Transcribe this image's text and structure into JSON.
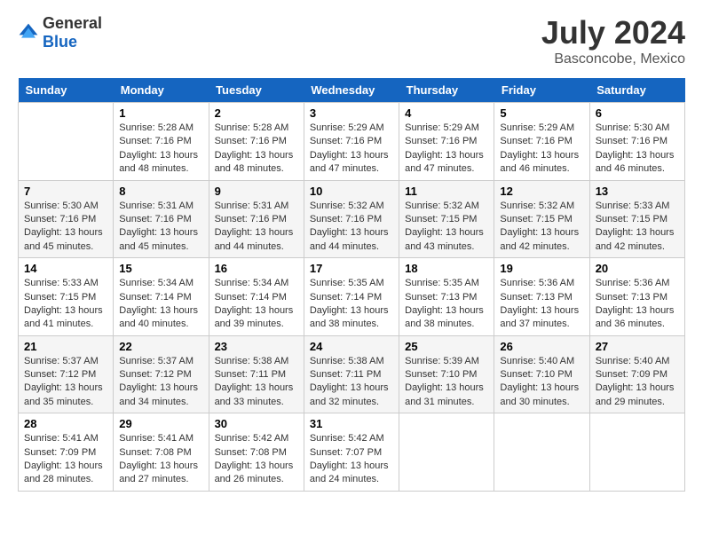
{
  "header": {
    "logo_general": "General",
    "logo_blue": "Blue",
    "title": "July 2024",
    "subtitle": "Basconcobe, Mexico"
  },
  "calendar": {
    "days_of_week": [
      "Sunday",
      "Monday",
      "Tuesday",
      "Wednesday",
      "Thursday",
      "Friday",
      "Saturday"
    ],
    "weeks": [
      [
        {
          "day": "",
          "info": ""
        },
        {
          "day": "1",
          "info": "Sunrise: 5:28 AM\nSunset: 7:16 PM\nDaylight: 13 hours and 48 minutes."
        },
        {
          "day": "2",
          "info": "Sunrise: 5:28 AM\nSunset: 7:16 PM\nDaylight: 13 hours and 48 minutes."
        },
        {
          "day": "3",
          "info": "Sunrise: 5:29 AM\nSunset: 7:16 PM\nDaylight: 13 hours and 47 minutes."
        },
        {
          "day": "4",
          "info": "Sunrise: 5:29 AM\nSunset: 7:16 PM\nDaylight: 13 hours and 47 minutes."
        },
        {
          "day": "5",
          "info": "Sunrise: 5:29 AM\nSunset: 7:16 PM\nDaylight: 13 hours and 46 minutes."
        },
        {
          "day": "6",
          "info": "Sunrise: 5:30 AM\nSunset: 7:16 PM\nDaylight: 13 hours and 46 minutes."
        }
      ],
      [
        {
          "day": "7",
          "info": "Sunrise: 5:30 AM\nSunset: 7:16 PM\nDaylight: 13 hours and 45 minutes."
        },
        {
          "day": "8",
          "info": "Sunrise: 5:31 AM\nSunset: 7:16 PM\nDaylight: 13 hours and 45 minutes."
        },
        {
          "day": "9",
          "info": "Sunrise: 5:31 AM\nSunset: 7:16 PM\nDaylight: 13 hours and 44 minutes."
        },
        {
          "day": "10",
          "info": "Sunrise: 5:32 AM\nSunset: 7:16 PM\nDaylight: 13 hours and 44 minutes."
        },
        {
          "day": "11",
          "info": "Sunrise: 5:32 AM\nSunset: 7:15 PM\nDaylight: 13 hours and 43 minutes."
        },
        {
          "day": "12",
          "info": "Sunrise: 5:32 AM\nSunset: 7:15 PM\nDaylight: 13 hours and 42 minutes."
        },
        {
          "day": "13",
          "info": "Sunrise: 5:33 AM\nSunset: 7:15 PM\nDaylight: 13 hours and 42 minutes."
        }
      ],
      [
        {
          "day": "14",
          "info": "Sunrise: 5:33 AM\nSunset: 7:15 PM\nDaylight: 13 hours and 41 minutes."
        },
        {
          "day": "15",
          "info": "Sunrise: 5:34 AM\nSunset: 7:14 PM\nDaylight: 13 hours and 40 minutes."
        },
        {
          "day": "16",
          "info": "Sunrise: 5:34 AM\nSunset: 7:14 PM\nDaylight: 13 hours and 39 minutes."
        },
        {
          "day": "17",
          "info": "Sunrise: 5:35 AM\nSunset: 7:14 PM\nDaylight: 13 hours and 38 minutes."
        },
        {
          "day": "18",
          "info": "Sunrise: 5:35 AM\nSunset: 7:13 PM\nDaylight: 13 hours and 38 minutes."
        },
        {
          "day": "19",
          "info": "Sunrise: 5:36 AM\nSunset: 7:13 PM\nDaylight: 13 hours and 37 minutes."
        },
        {
          "day": "20",
          "info": "Sunrise: 5:36 AM\nSunset: 7:13 PM\nDaylight: 13 hours and 36 minutes."
        }
      ],
      [
        {
          "day": "21",
          "info": "Sunrise: 5:37 AM\nSunset: 7:12 PM\nDaylight: 13 hours and 35 minutes."
        },
        {
          "day": "22",
          "info": "Sunrise: 5:37 AM\nSunset: 7:12 PM\nDaylight: 13 hours and 34 minutes."
        },
        {
          "day": "23",
          "info": "Sunrise: 5:38 AM\nSunset: 7:11 PM\nDaylight: 13 hours and 33 minutes."
        },
        {
          "day": "24",
          "info": "Sunrise: 5:38 AM\nSunset: 7:11 PM\nDaylight: 13 hours and 32 minutes."
        },
        {
          "day": "25",
          "info": "Sunrise: 5:39 AM\nSunset: 7:10 PM\nDaylight: 13 hours and 31 minutes."
        },
        {
          "day": "26",
          "info": "Sunrise: 5:40 AM\nSunset: 7:10 PM\nDaylight: 13 hours and 30 minutes."
        },
        {
          "day": "27",
          "info": "Sunrise: 5:40 AM\nSunset: 7:09 PM\nDaylight: 13 hours and 29 minutes."
        }
      ],
      [
        {
          "day": "28",
          "info": "Sunrise: 5:41 AM\nSunset: 7:09 PM\nDaylight: 13 hours and 28 minutes."
        },
        {
          "day": "29",
          "info": "Sunrise: 5:41 AM\nSunset: 7:08 PM\nDaylight: 13 hours and 27 minutes."
        },
        {
          "day": "30",
          "info": "Sunrise: 5:42 AM\nSunset: 7:08 PM\nDaylight: 13 hours and 26 minutes."
        },
        {
          "day": "31",
          "info": "Sunrise: 5:42 AM\nSunset: 7:07 PM\nDaylight: 13 hours and 24 minutes."
        },
        {
          "day": "",
          "info": ""
        },
        {
          "day": "",
          "info": ""
        },
        {
          "day": "",
          "info": ""
        }
      ]
    ]
  }
}
